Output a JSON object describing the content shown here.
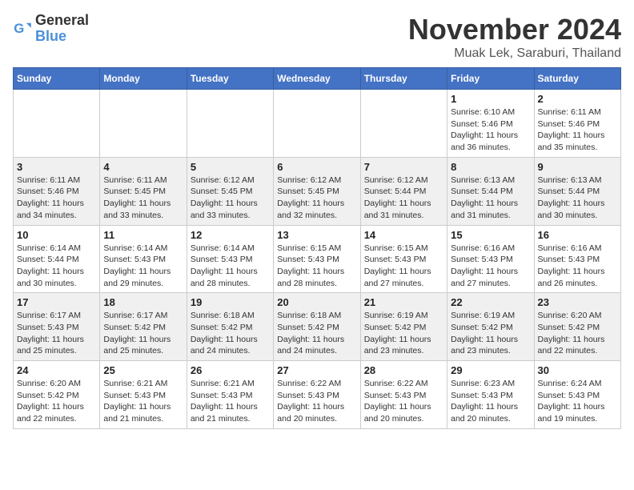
{
  "header": {
    "logo_general": "General",
    "logo_blue": "Blue",
    "month": "November 2024",
    "location": "Muak Lek, Saraburi, Thailand"
  },
  "weekdays": [
    "Sunday",
    "Monday",
    "Tuesday",
    "Wednesday",
    "Thursday",
    "Friday",
    "Saturday"
  ],
  "weeks": [
    [
      {
        "day": "",
        "info": ""
      },
      {
        "day": "",
        "info": ""
      },
      {
        "day": "",
        "info": ""
      },
      {
        "day": "",
        "info": ""
      },
      {
        "day": "",
        "info": ""
      },
      {
        "day": "1",
        "info": "Sunrise: 6:10 AM\nSunset: 5:46 PM\nDaylight: 11 hours and 36 minutes."
      },
      {
        "day": "2",
        "info": "Sunrise: 6:11 AM\nSunset: 5:46 PM\nDaylight: 11 hours and 35 minutes."
      }
    ],
    [
      {
        "day": "3",
        "info": "Sunrise: 6:11 AM\nSunset: 5:46 PM\nDaylight: 11 hours and 34 minutes."
      },
      {
        "day": "4",
        "info": "Sunrise: 6:11 AM\nSunset: 5:45 PM\nDaylight: 11 hours and 33 minutes."
      },
      {
        "day": "5",
        "info": "Sunrise: 6:12 AM\nSunset: 5:45 PM\nDaylight: 11 hours and 33 minutes."
      },
      {
        "day": "6",
        "info": "Sunrise: 6:12 AM\nSunset: 5:45 PM\nDaylight: 11 hours and 32 minutes."
      },
      {
        "day": "7",
        "info": "Sunrise: 6:12 AM\nSunset: 5:44 PM\nDaylight: 11 hours and 31 minutes."
      },
      {
        "day": "8",
        "info": "Sunrise: 6:13 AM\nSunset: 5:44 PM\nDaylight: 11 hours and 31 minutes."
      },
      {
        "day": "9",
        "info": "Sunrise: 6:13 AM\nSunset: 5:44 PM\nDaylight: 11 hours and 30 minutes."
      }
    ],
    [
      {
        "day": "10",
        "info": "Sunrise: 6:14 AM\nSunset: 5:44 PM\nDaylight: 11 hours and 30 minutes."
      },
      {
        "day": "11",
        "info": "Sunrise: 6:14 AM\nSunset: 5:43 PM\nDaylight: 11 hours and 29 minutes."
      },
      {
        "day": "12",
        "info": "Sunrise: 6:14 AM\nSunset: 5:43 PM\nDaylight: 11 hours and 28 minutes."
      },
      {
        "day": "13",
        "info": "Sunrise: 6:15 AM\nSunset: 5:43 PM\nDaylight: 11 hours and 28 minutes."
      },
      {
        "day": "14",
        "info": "Sunrise: 6:15 AM\nSunset: 5:43 PM\nDaylight: 11 hours and 27 minutes."
      },
      {
        "day": "15",
        "info": "Sunrise: 6:16 AM\nSunset: 5:43 PM\nDaylight: 11 hours and 27 minutes."
      },
      {
        "day": "16",
        "info": "Sunrise: 6:16 AM\nSunset: 5:43 PM\nDaylight: 11 hours and 26 minutes."
      }
    ],
    [
      {
        "day": "17",
        "info": "Sunrise: 6:17 AM\nSunset: 5:43 PM\nDaylight: 11 hours and 25 minutes."
      },
      {
        "day": "18",
        "info": "Sunrise: 6:17 AM\nSunset: 5:42 PM\nDaylight: 11 hours and 25 minutes."
      },
      {
        "day": "19",
        "info": "Sunrise: 6:18 AM\nSunset: 5:42 PM\nDaylight: 11 hours and 24 minutes."
      },
      {
        "day": "20",
        "info": "Sunrise: 6:18 AM\nSunset: 5:42 PM\nDaylight: 11 hours and 24 minutes."
      },
      {
        "day": "21",
        "info": "Sunrise: 6:19 AM\nSunset: 5:42 PM\nDaylight: 11 hours and 23 minutes."
      },
      {
        "day": "22",
        "info": "Sunrise: 6:19 AM\nSunset: 5:42 PM\nDaylight: 11 hours and 23 minutes."
      },
      {
        "day": "23",
        "info": "Sunrise: 6:20 AM\nSunset: 5:42 PM\nDaylight: 11 hours and 22 minutes."
      }
    ],
    [
      {
        "day": "24",
        "info": "Sunrise: 6:20 AM\nSunset: 5:42 PM\nDaylight: 11 hours and 22 minutes."
      },
      {
        "day": "25",
        "info": "Sunrise: 6:21 AM\nSunset: 5:43 PM\nDaylight: 11 hours and 21 minutes."
      },
      {
        "day": "26",
        "info": "Sunrise: 6:21 AM\nSunset: 5:43 PM\nDaylight: 11 hours and 21 minutes."
      },
      {
        "day": "27",
        "info": "Sunrise: 6:22 AM\nSunset: 5:43 PM\nDaylight: 11 hours and 20 minutes."
      },
      {
        "day": "28",
        "info": "Sunrise: 6:22 AM\nSunset: 5:43 PM\nDaylight: 11 hours and 20 minutes."
      },
      {
        "day": "29",
        "info": "Sunrise: 6:23 AM\nSunset: 5:43 PM\nDaylight: 11 hours and 20 minutes."
      },
      {
        "day": "30",
        "info": "Sunrise: 6:24 AM\nSunset: 5:43 PM\nDaylight: 11 hours and 19 minutes."
      }
    ]
  ]
}
